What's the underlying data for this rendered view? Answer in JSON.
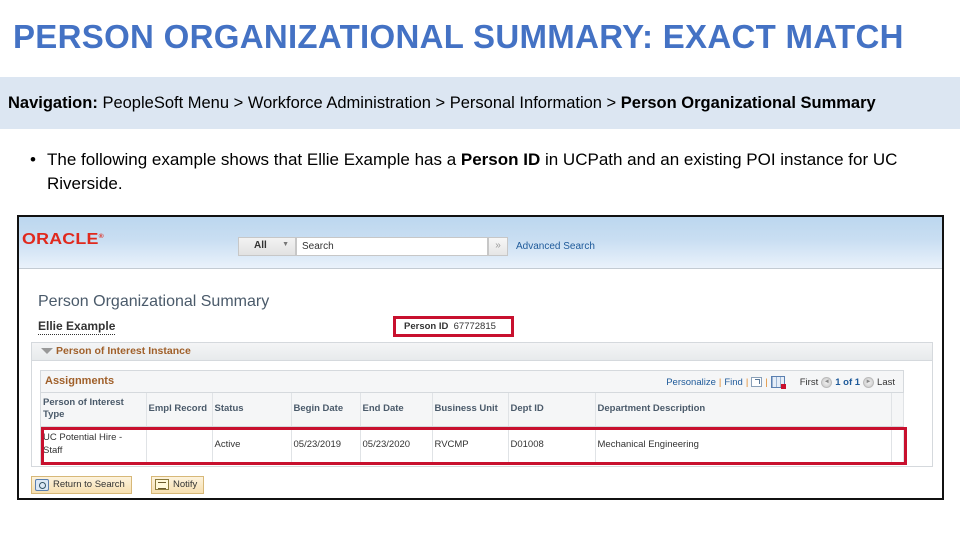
{
  "slide": {
    "title": "PERSON ORGANIZATIONAL SUMMARY: EXACT MATCH",
    "navigation": {
      "label": "Navigation:",
      "path": "PeopleSoft Menu > Workforce Administration > Personal Information > ",
      "current": "Person Organizational Summary"
    },
    "bullet": {
      "symbol": "•",
      "text_before": "The following example shows that Ellie Example has a ",
      "bold": "Person ID",
      "text_after": " in UCPath and an existing POI instance for UC Riverside."
    }
  },
  "app": {
    "logo": "ORACLE",
    "logo_mark": "®",
    "search": {
      "scope": "All",
      "placeholder": "Search",
      "go_symbol": "»",
      "advanced_label": "Advanced Search"
    },
    "page_title": "Person Organizational Summary",
    "person_name": "Ellie Example",
    "person_id_label": "Person ID",
    "person_id_value": "67772815",
    "section_title": "Person of Interest Instance",
    "grid": {
      "title": "Assignments",
      "personalize": "Personalize",
      "find": "Find",
      "separator": "|",
      "first": "First",
      "pager": "1 of 1",
      "last": "Last",
      "prev_symbol": "◄",
      "next_symbol": "►",
      "columns": [
        "Person of Interest Type",
        "Empl Record",
        "Status",
        "Begin Date",
        "End Date",
        "Business Unit",
        "Dept ID",
        "Department Description"
      ],
      "rows": [
        {
          "poi_type": "UC Potential Hire - Staff",
          "empl_record": "",
          "status": "Active",
          "begin_date": "05/23/2019",
          "end_date": "05/23/2020",
          "business_unit": "RVCMP",
          "dept_id": "D01008",
          "dept_description": "Mechanical Engineering"
        }
      ]
    },
    "buttons": {
      "return_to_search": "Return to Search",
      "notify": "Notify"
    },
    "colors": {
      "title_blue": "#4472c4",
      "highlight_red": "#c8102e",
      "oracle_red": "#e0291d",
      "section_brown": "#a0602a",
      "link_blue": "#1e5a9a"
    }
  }
}
